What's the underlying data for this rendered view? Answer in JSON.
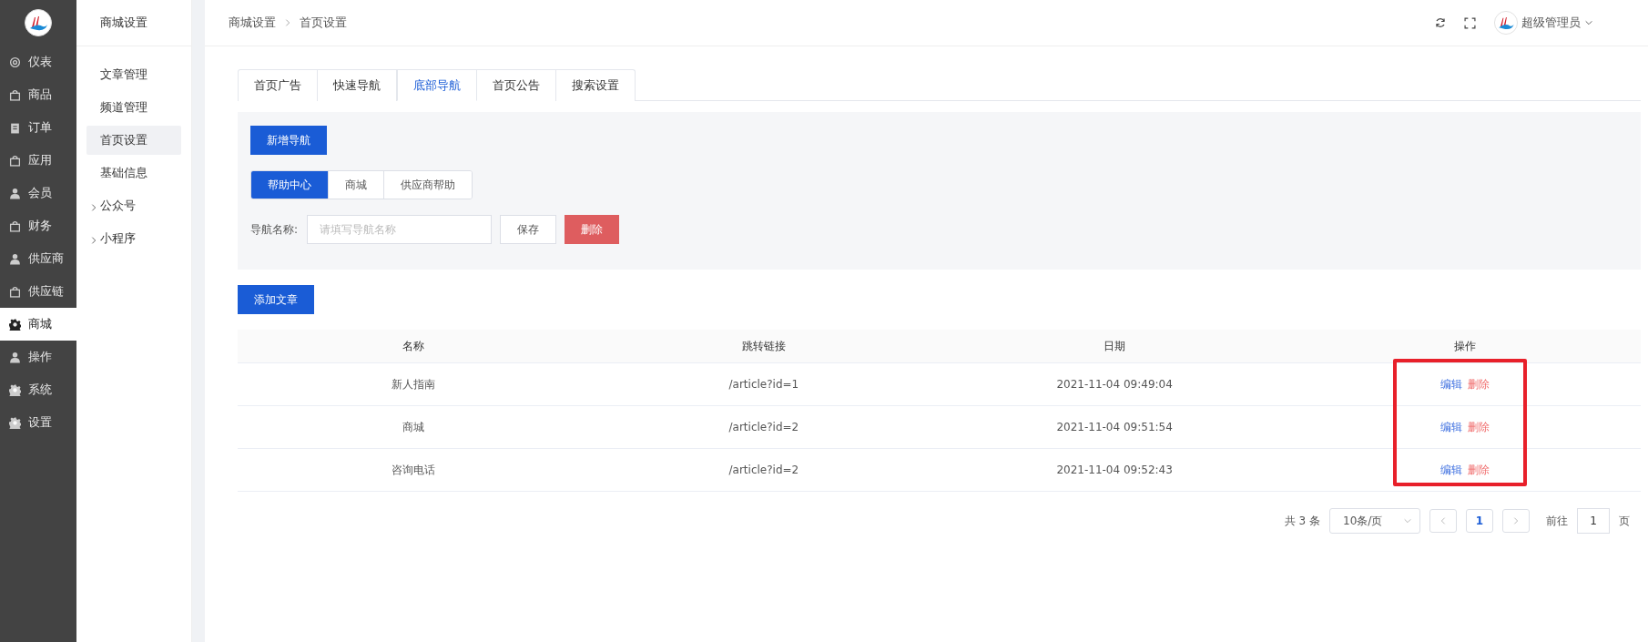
{
  "nav": [
    {
      "label": "仪表",
      "kind": "dial",
      "selected": false
    },
    {
      "label": "商品",
      "kind": "bag",
      "selected": false
    },
    {
      "label": "订单",
      "kind": "clipboard",
      "selected": false
    },
    {
      "label": "应用",
      "kind": "bag",
      "selected": false
    },
    {
      "label": "会员",
      "kind": "person",
      "selected": false
    },
    {
      "label": "财务",
      "kind": "bag",
      "selected": false
    },
    {
      "label": "供应商",
      "kind": "person",
      "selected": false
    },
    {
      "label": "供应链",
      "kind": "bag",
      "selected": false
    },
    {
      "label": "商城",
      "kind": "gear",
      "selected": true
    },
    {
      "label": "操作",
      "kind": "person",
      "selected": false
    },
    {
      "label": "系统",
      "kind": "gear",
      "selected": false
    },
    {
      "label": "设置",
      "kind": "gear",
      "selected": false
    }
  ],
  "subnav": {
    "title": "商城设置",
    "items": [
      {
        "label": "文章管理",
        "kind": "link",
        "selected": false
      },
      {
        "label": "频道管理",
        "kind": "link",
        "selected": false
      },
      {
        "label": "首页设置",
        "kind": "link",
        "selected": true
      },
      {
        "label": "基础信息",
        "kind": "link",
        "selected": false
      },
      {
        "label": "公众号",
        "kind": "group",
        "selected": false
      },
      {
        "label": "小程序",
        "kind": "group",
        "selected": false
      }
    ]
  },
  "breadcrumb": [
    "商城设置",
    "首页设置"
  ],
  "user": {
    "name": "超级管理员"
  },
  "tabs": [
    {
      "label": "首页广告",
      "selected": false
    },
    {
      "label": "快速导航",
      "selected": false
    },
    {
      "label": "底部导航",
      "selected": true
    },
    {
      "label": "首页公告",
      "selected": false
    },
    {
      "label": "搜索设置",
      "selected": false
    }
  ],
  "add_nav_button": "新增导航",
  "nav_groups": [
    {
      "label": "帮助中心",
      "selected": true
    },
    {
      "label": "商城",
      "selected": false
    },
    {
      "label": "供应商帮助",
      "selected": false
    }
  ],
  "name_field": {
    "label": "导航名称:",
    "placeholder": "请填写导航名称"
  },
  "save_button": "保存",
  "delete_button": "删除",
  "add_article_button": "添加文章",
  "table": {
    "columns": [
      "名称",
      "跳转链接",
      "日期",
      "操作"
    ],
    "rows": [
      {
        "name": "新人指南",
        "link": "/article?id=1",
        "date": "2021-11-04 09:49:04",
        "edit": "编辑",
        "delete": "删除"
      },
      {
        "name": "商城",
        "link": "/article?id=2",
        "date": "2021-11-04 09:51:54",
        "edit": "编辑",
        "delete": "删除"
      },
      {
        "name": "咨询电话",
        "link": "/article?id=2",
        "date": "2021-11-04 09:52:43",
        "edit": "编辑",
        "delete": "删除"
      }
    ]
  },
  "pagination": {
    "total": "共 3 条",
    "page_size": "10条/页",
    "pages": [
      {
        "label": "1",
        "selected": true
      }
    ],
    "goto_label": "前往",
    "goto_value": "1",
    "page_unit": "页"
  }
}
